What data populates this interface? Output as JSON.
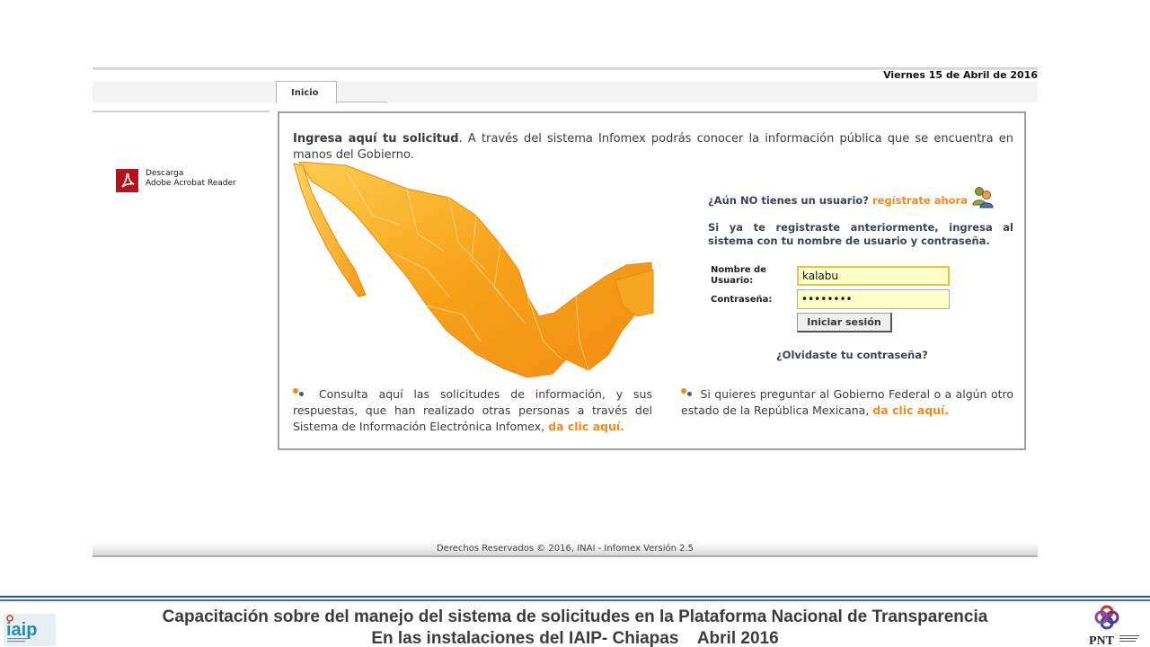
{
  "header": {
    "date": "Viernes 15 de Abril de 2016"
  },
  "tabs": [
    {
      "label": "Inicio"
    }
  ],
  "sidebar": {
    "acrobat_line1": "Descarga",
    "acrobat_line2": "Adobe Acrobat Reader"
  },
  "intro": {
    "bold": "Ingresa aquí tu solicitud",
    "text": ". A través del sistema Infomex podrás conocer la información pública que se encuentra en manos del Gobierno."
  },
  "login": {
    "no_user_question": "¿Aún NO tienes un usuario?",
    "register_link": "regístrate ahora",
    "already_registered": "Si ya te registraste anteriormente, ingresa al sistema con tu nombre de usuario y contraseña.",
    "username_label_1": "Nombre de",
    "username_label_2": "Usuario:",
    "username_value": "kalabu",
    "password_label": "Contraseña:",
    "password_value": "••••••••",
    "submit_label": "Iniciar sesión",
    "forgot_link": "¿Olvidaste tu contraseña?"
  },
  "bullets": {
    "consulta_text": "Consulta aquí las solicitudes de información, y sus respuestas, que han realizado otras personas a través del Sistema de Información Electrónica Infomex, ",
    "consulta_link": "da clic aquí.",
    "federal_text": "Si quieres preguntar al Gobierno Federal o a algún otro estado de la República Mexicana, ",
    "federal_link": "da clic aquí."
  },
  "footer": {
    "copyright": "Derechos Reservados © 2016, INAI - Infomex Versión 2.5"
  },
  "slide": {
    "caption_line1": "Capacitación sobre del manejo del sistema de solicitudes en la Plataforma Nacional de Transparencia",
    "caption_line2": "En las instalaciones del IAIP- Chiapas    Abril 2016",
    "iaip_logo_text": "iaip",
    "pnt_logo_text": "PNT"
  },
  "colors": {
    "accent_orange": "#f08a1c",
    "panel_border": "#a0a0a0",
    "input_bg": "#ffffc8",
    "slide_rule": "#2d4b8f"
  }
}
